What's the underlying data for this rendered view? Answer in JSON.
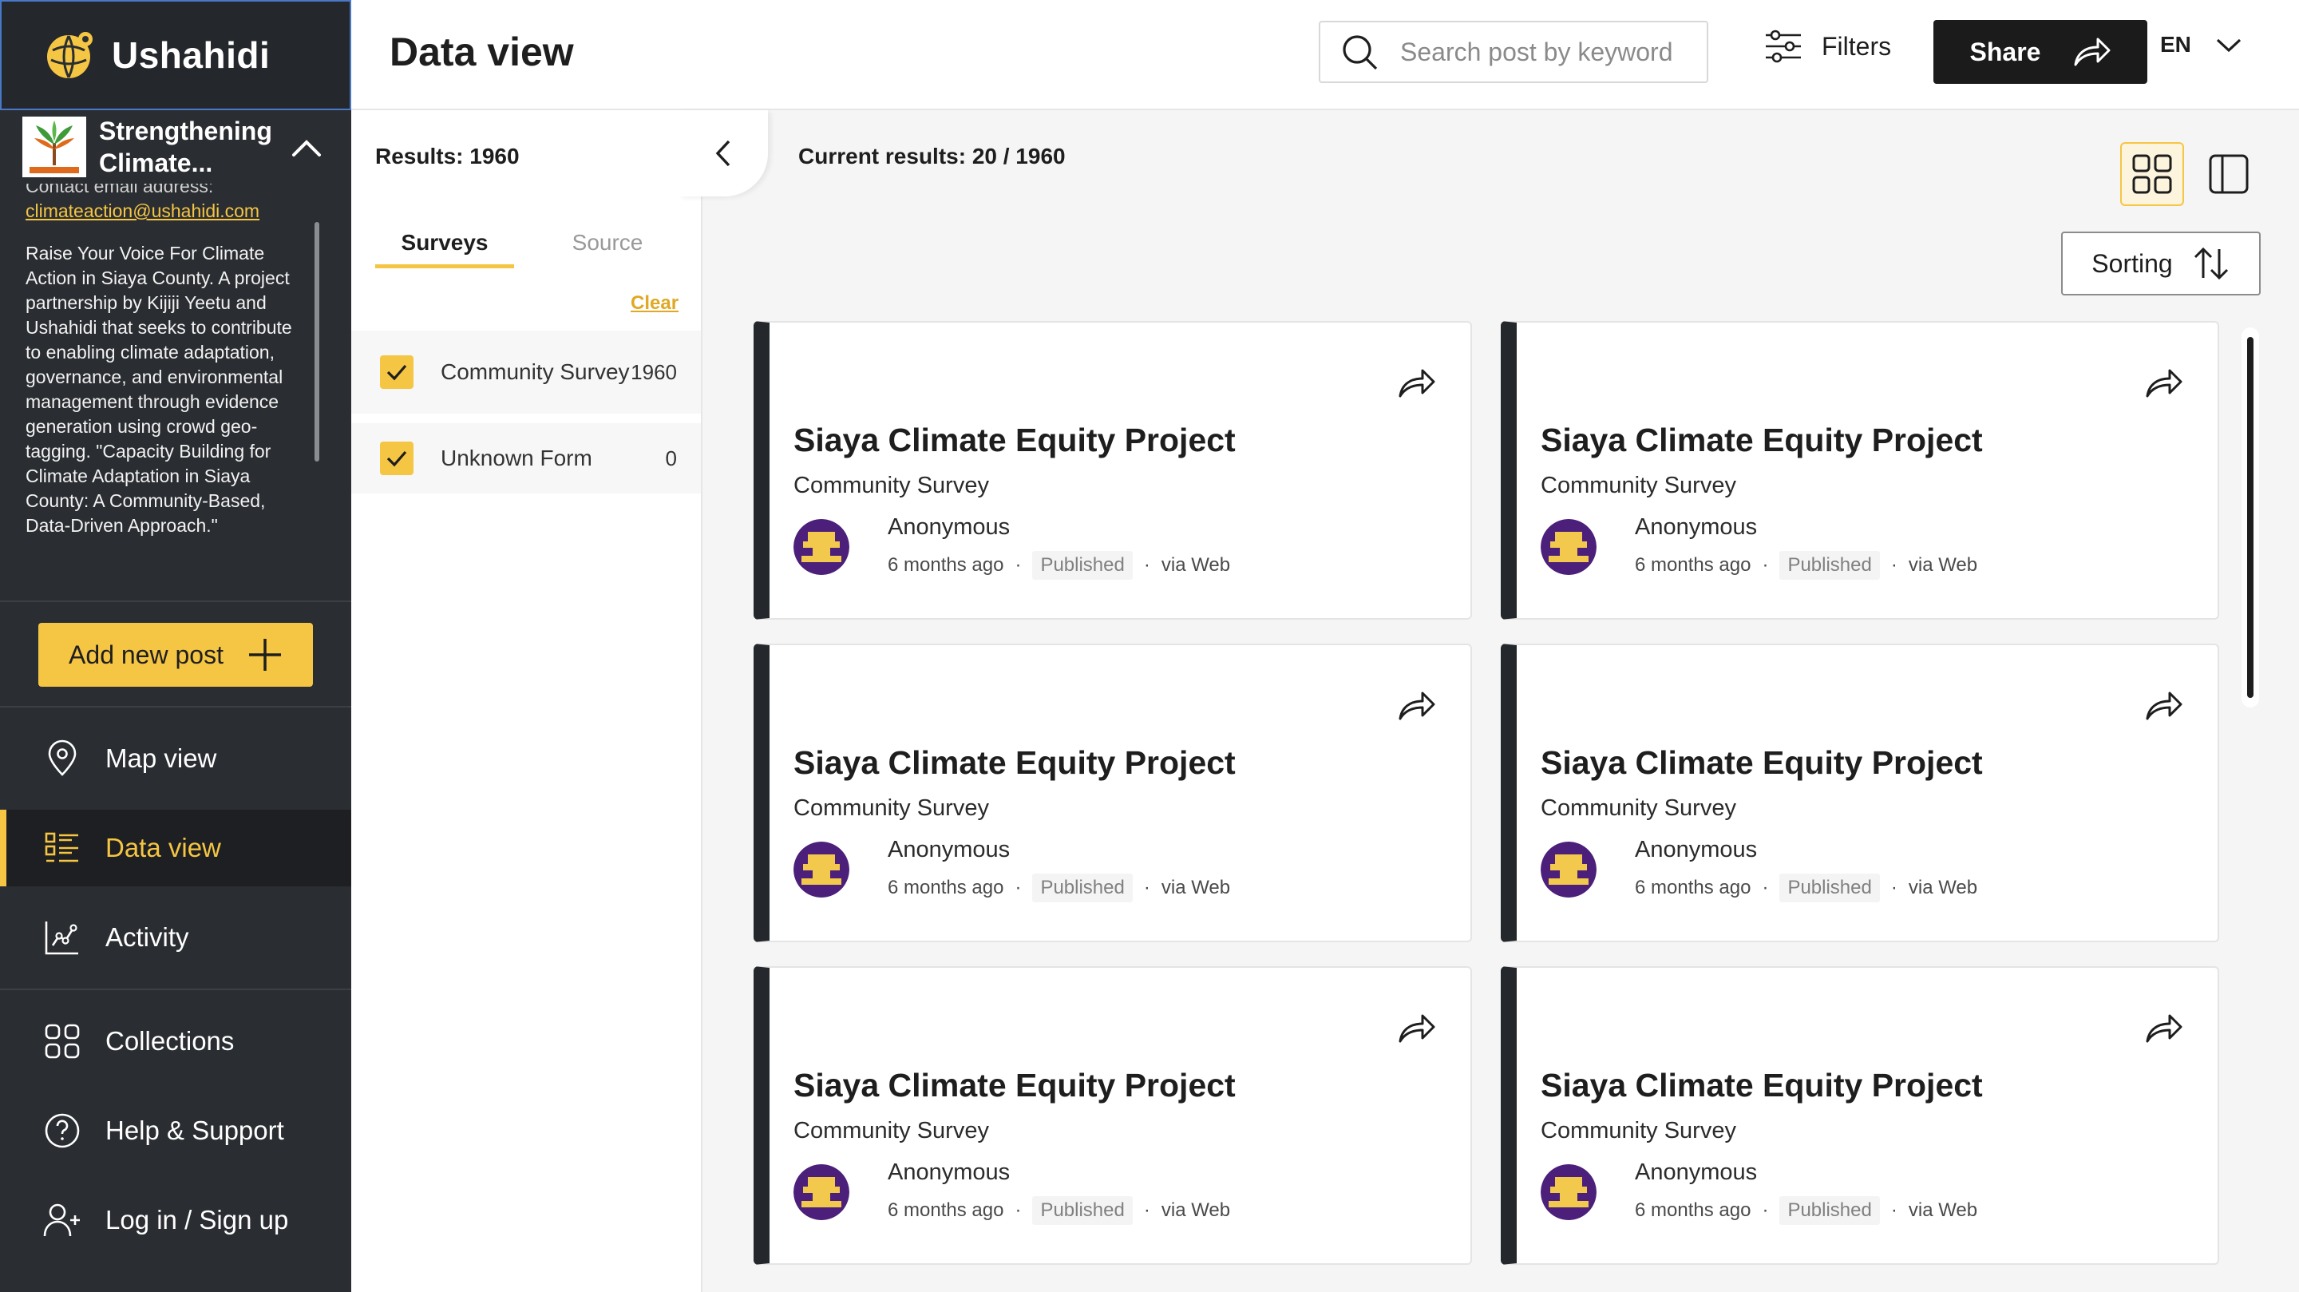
{
  "app": {
    "name": "Ushahidi",
    "accent": "#f5c544",
    "sidebar_bg": "#2a2d31"
  },
  "deployment": {
    "title": "Strengthening Climate...",
    "partial_line": "Contact email address:",
    "email": "climateaction@ushahidi.com",
    "description": "Raise Your Voice For Climate Action in Siaya County. A project partnership by Kijiji Yeetu and Ushahidi that seeks to contribute to enabling climate adaptation, governance, and environmental management through evidence generation using crowd geo-tagging. \"Capacity Building for Climate Adaptation in Siaya County: A Community-Based, Data-Driven Approach.\""
  },
  "sidebar": {
    "add_post": "Add new post",
    "nav": [
      {
        "label": "Map view",
        "icon": "map-pin-icon"
      },
      {
        "label": "Data view",
        "icon": "data-list-icon",
        "active": true
      },
      {
        "label": "Activity",
        "icon": "activity-chart-icon"
      },
      {
        "label": "Collections",
        "icon": "collections-icon"
      },
      {
        "label": "Help & Support",
        "icon": "help-icon"
      },
      {
        "label": "Log in / Sign up",
        "icon": "add-user-icon"
      }
    ]
  },
  "header": {
    "title": "Data view",
    "search_placeholder": "Search post by keyword",
    "filters_label": "Filters",
    "share_label": "Share",
    "language": "EN"
  },
  "filter_panel": {
    "results_label": "Results: 1960",
    "tabs": [
      "Surveys",
      "Source"
    ],
    "clear_label": "Clear",
    "options": [
      {
        "label": "Community Survey",
        "count": "1960",
        "checked": true
      },
      {
        "label": "Unknown Form",
        "count": "0",
        "checked": true
      }
    ]
  },
  "main": {
    "current_results": "Current results: 20 / 1960",
    "sorting_label": "Sorting"
  },
  "posts": [
    {
      "title": "Siaya Climate Equity Project",
      "survey": "Community Survey",
      "author": "Anonymous",
      "time": "6 months ago",
      "status": "Published",
      "source": "via Web"
    },
    {
      "title": "Siaya Climate Equity Project",
      "survey": "Community Survey",
      "author": "Anonymous",
      "time": "6 months ago",
      "status": "Published",
      "source": "via Web"
    },
    {
      "title": "Siaya Climate Equity Project",
      "survey": "Community Survey",
      "author": "Anonymous",
      "time": "6 months ago",
      "status": "Published",
      "source": "via Web"
    },
    {
      "title": "Siaya Climate Equity Project",
      "survey": "Community Survey",
      "author": "Anonymous",
      "time": "6 months ago",
      "status": "Published",
      "source": "via Web"
    },
    {
      "title": "Siaya Climate Equity Project",
      "survey": "Community Survey",
      "author": "Anonymous",
      "time": "6 months ago",
      "status": "Published",
      "source": "via Web"
    },
    {
      "title": "Siaya Climate Equity Project",
      "survey": "Community Survey",
      "author": "Anonymous",
      "time": "6 months ago",
      "status": "Published",
      "source": "via Web"
    }
  ]
}
